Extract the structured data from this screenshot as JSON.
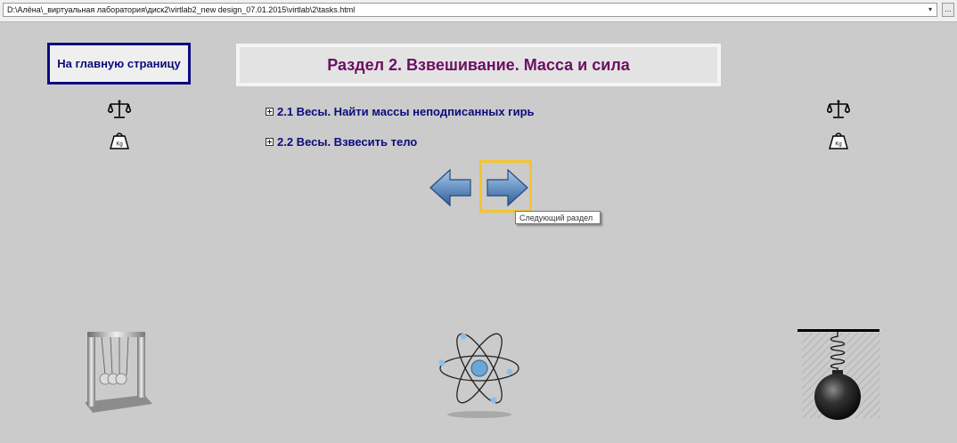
{
  "address_bar": {
    "url": "D:\\Алёна\\_виртуальная лаборатория\\диск2\\virtlab2_new design_07.01.2015\\virtlab\\2\\tasks.html",
    "dropdown_glyph": "▾",
    "go_button": "..."
  },
  "home_button": {
    "label": "На главную страницу"
  },
  "page_title": "Раздел 2. Взвешивание. Масса и сила",
  "tasks": [
    {
      "label": "2.1 Весы. Найти массы неподписанных гирь"
    },
    {
      "label": "2.2 Весы. Взвесить тело"
    }
  ],
  "icons": {
    "left_column": [
      "balance-scale-icon",
      "kg-weight-icon"
    ],
    "right_column": [
      "balance-scale-icon",
      "kg-weight-icon"
    ],
    "weight_unit": "Kg"
  },
  "navigation": {
    "prev": "arrow-left-icon",
    "next": "arrow-right-icon",
    "focus_color": "#f4c430",
    "tooltip": "Следующий раздел"
  },
  "illustrations": [
    "newtons-cradle-icon",
    "atom-icon",
    "spring-pendulum-icon"
  ],
  "colors": {
    "background": "#cbcbcb",
    "link": "#0b0b7e",
    "title": "#6b0f63",
    "arrow": "#4a7fb8"
  }
}
